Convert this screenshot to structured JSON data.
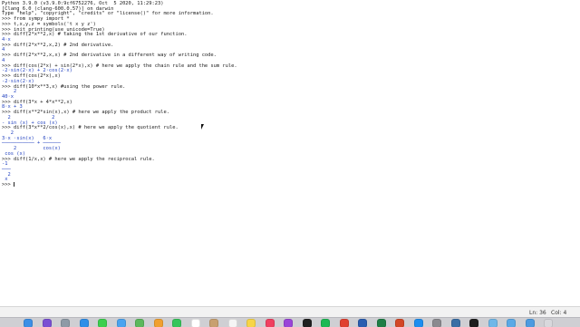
{
  "terminal": {
    "lines": [
      {
        "text": "Python 3.9.0 (v3.9.0:9cf6752276, Oct  5 2020, 11:29:23)",
        "color": "#1a1a1a"
      },
      {
        "text": "[Clang 6.0 (clang-600.0.57)] on darwin",
        "color": "#1a1a1a"
      },
      {
        "text": "Type \"help\", \"copyright\", \"credits\" or \"license()\" for more information.",
        "color": "#1a1a1a"
      },
      {
        "text": ">>> from sympy import *",
        "color": "#1a1a1a"
      },
      {
        "text": ">>> t,x,y,z = symbols('t x y z')",
        "color": "#1a1a1a"
      },
      {
        "text": ">>> init_printing(use_unicode=True)",
        "color": "#1a1a1a"
      },
      {
        "text": ">>> diff(2*x**2,x) # taking the 1st derivative of our function.",
        "color": "#1a1a1a"
      },
      {
        "text": "4·x",
        "color": "#1f3fbf"
      },
      {
        "text": ">>> diff(2*x**2,x,2) # 2nd derivative.",
        "color": "#1a1a1a"
      },
      {
        "text": "4",
        "color": "#1f3fbf"
      },
      {
        "text": ">>> diff(2*x**2,x,x) # 2nd derivative in a different way of writing code.",
        "color": "#1a1a1a"
      },
      {
        "text": "4",
        "color": "#1f3fbf"
      },
      {
        "text": ">>> diff(cos(2*x) + sin(2*x),x) # here we apply the chain rule and the sum rule.",
        "color": "#1a1a1a"
      },
      {
        "text": "-2·sin(2·x) + 2·cos(2·x)",
        "color": "#1f3fbf"
      },
      {
        "text": ">>> diff(cos(2*x),x)",
        "color": "#1a1a1a"
      },
      {
        "text": "-2·sin(2·x)",
        "color": "#1f3fbf"
      },
      {
        "text": ">>> diff(10*x**3,x) #using the power rule.",
        "color": "#1a1a1a"
      },
      {
        "text": "    2",
        "color": "#1f3fbf"
      },
      {
        "text": "40·x",
        "color": "#1f3fbf"
      },
      {
        "text": ">>> diff(3*x + 4*x**2,x)",
        "color": "#1a1a1a"
      },
      {
        "text": "8·x + 3",
        "color": "#1f3fbf"
      },
      {
        "text": ">>> diff(x**2*sin(x),x) # here we apply the product rule.",
        "color": "#1a1a1a"
      },
      {
        "text": "  2              2",
        "color": "#1f3fbf"
      },
      {
        "text": "- sin (x) + cos (x)",
        "color": "#1f3fbf"
      },
      {
        "text": ">>> diff(3*x**2/cos(x),x) # here we apply the quotient rule.",
        "color": "#1a1a1a"
      },
      {
        "text": "   2",
        "color": "#1f3fbf"
      },
      {
        "text": "3·x ·sin(x)   6·x",
        "color": "#1f3fbf"
      },
      {
        "text": "─────────── + ──────",
        "color": "#1f3fbf"
      },
      {
        "text": "    2         cos(x)",
        "color": "#1f3fbf"
      },
      {
        "text": " cos (x)",
        "color": "#1f3fbf"
      },
      {
        "text": ">>> diff(1/x,x) # here we apply the reciprocal rule.",
        "color": "#1a1a1a"
      },
      {
        "text": "-1",
        "color": "#1f3fbf"
      },
      {
        "text": "───",
        "color": "#1f3fbf"
      },
      {
        "text": "  2",
        "color": "#1f3fbf"
      },
      {
        "text": " x",
        "color": "#1f3fbf"
      },
      {
        "text": ">>> ",
        "color": "#1a1a1a",
        "cursor": true
      }
    ]
  },
  "status_bar": {
    "line": "Ln: 36",
    "col": "Col: 4"
  },
  "dock": {
    "icons": [
      {
        "name": "finder-icon",
        "color": "#3b8fe6"
      },
      {
        "name": "siri-icon",
        "color": "#7a4fd3"
      },
      {
        "name": "launchpad-icon",
        "color": "#8e9aa6"
      },
      {
        "name": "safari-icon",
        "color": "#2f8ee8"
      },
      {
        "name": "messages-icon",
        "color": "#3ccf4e"
      },
      {
        "name": "mail-icon",
        "color": "#4aa3f0"
      },
      {
        "name": "maps-icon",
        "color": "#5cb85c"
      },
      {
        "name": "photos-icon",
        "color": "#f0a030"
      },
      {
        "name": "facetime-icon",
        "color": "#36c55a"
      },
      {
        "name": "calendar-icon",
        "color": "#ffffff"
      },
      {
        "name": "contacts-icon",
        "color": "#c8a070"
      },
      {
        "name": "reminders-icon",
        "color": "#f5f5f5"
      },
      {
        "name": "notes-icon",
        "color": "#f7d548"
      },
      {
        "name": "music-icon",
        "color": "#f04060"
      },
      {
        "name": "podcasts-icon",
        "color": "#9a45d8"
      },
      {
        "name": "tv-icon",
        "color": "#202020"
      },
      {
        "name": "spotify-icon",
        "color": "#1db954"
      },
      {
        "name": "chrome-icon",
        "color": "#e04030"
      },
      {
        "name": "word-icon",
        "color": "#2a5db0"
      },
      {
        "name": "excel-icon",
        "color": "#1e7e45"
      },
      {
        "name": "powerpoint-icon",
        "color": "#d24726"
      },
      {
        "name": "app-store-icon",
        "color": "#1c8ef0"
      },
      {
        "name": "system-preferences-icon",
        "color": "#8a8a8f"
      },
      {
        "name": "python-idle-icon",
        "color": "#3a6ea5"
      },
      {
        "name": "terminal-icon",
        "color": "#1d1d1d"
      },
      {
        "name": "preview-icon",
        "color": "#6fb7e8"
      },
      {
        "name": "folder-icon",
        "color": "#5aa9e6"
      },
      {
        "name": "downloads-icon",
        "color": "#4c9be0"
      },
      {
        "name": "trash-icon",
        "color": "#d8d8dc"
      }
    ]
  }
}
